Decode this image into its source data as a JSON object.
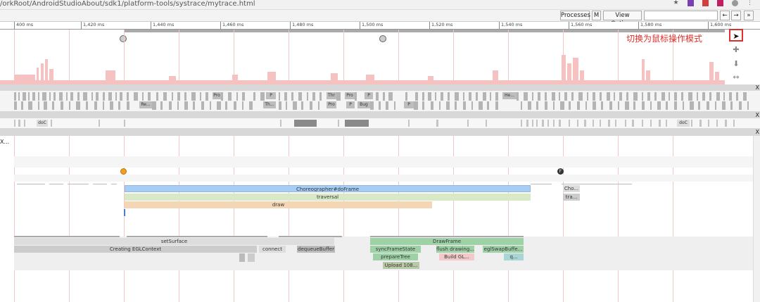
{
  "browser": {
    "url": "/orkRoot/AndroidStudioAbout/sdk1/platform-tools/systrace/mytrace.html"
  },
  "toolbar": {
    "processes_label": "Processes",
    "m_label": "M",
    "view_options_label": "View Options",
    "prev_label": "←",
    "next_label": "→",
    "more_label": "»"
  },
  "ruler": {
    "ticks": [
      "400 ms",
      "1,420 ms",
      "1,440 ms",
      "1,460 ms",
      "1,480 ms",
      "1,500 ms",
      "1,520 ms",
      "1,540 ms",
      "1,560 ms",
      "1,580 ms",
      "1,600 ms"
    ]
  },
  "hint_text": "切换为鼠标操作模式",
  "close_glyph": "X",
  "thread_label": "X...",
  "cpu_labels": [
    "Pro",
    "P",
    "Thr",
    "Pro",
    "P",
    "He...",
    "Re...",
    "Th...",
    "Pro",
    "P",
    "Bug",
    "P"
  ],
  "doc_labels": [
    "doC",
    "doC"
  ],
  "markers": {
    "frame_marker_f": "F"
  },
  "ui_thread": {
    "choreographer": "Choreographer#doFrame",
    "traversal": "traversal",
    "draw": "draw",
    "cho_short": "Cho...",
    "tra_short": "tra..."
  },
  "render_thread": {
    "set_surface": "setSurface",
    "creating_egl": "Creating EGLContext",
    "connect": "connect",
    "dequeue_buffer": "dequeueBuffer",
    "draw_frame": "DrawFrame",
    "sync_frame_state": "syncFrameState",
    "flush_drawing": "flush drawing...",
    "egl_swap": "eglSwapBuffe...",
    "prepare_tree": "prepareTree",
    "build_gl": "Build GL...",
    "q_short": "q...",
    "upload": "Upload 108..."
  },
  "colors": {
    "choreographer": "#a8cdf5",
    "traversal": "#d9e8c5",
    "draw": "#f3d6b6",
    "render_green": "#9fd1a7",
    "render_pink": "#f3c9c9",
    "hint_red": "#e0302a"
  }
}
